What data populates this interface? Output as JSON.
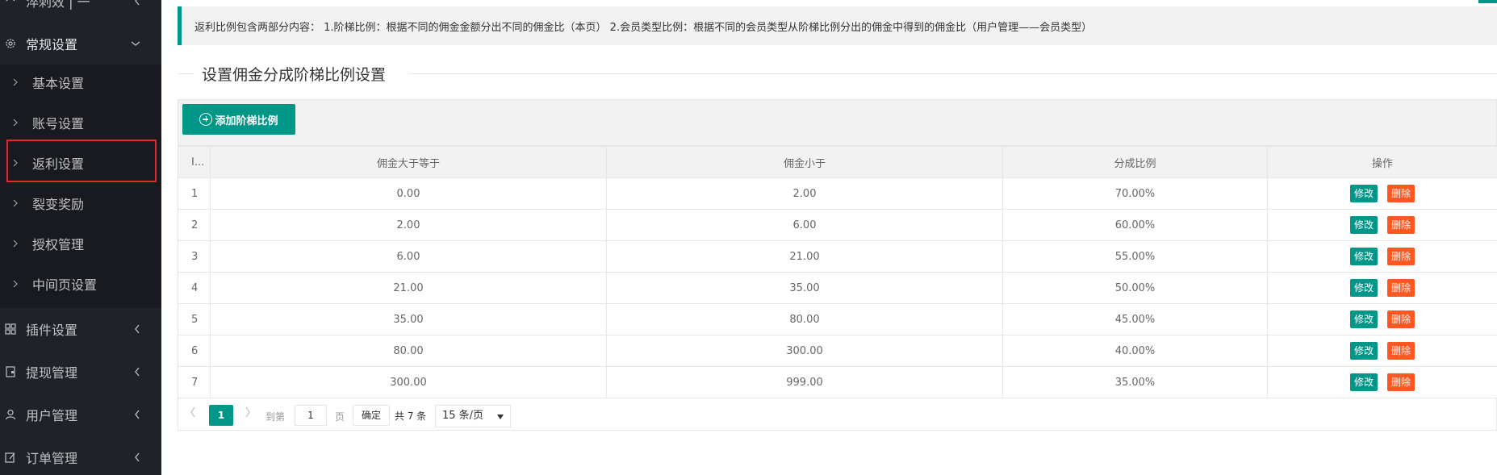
{
  "sidebar": {
    "top_item": "淬刺效 | 一",
    "general": {
      "label": "常规设置"
    },
    "sub_items": [
      {
        "label": "基本设置"
      },
      {
        "label": "账号设置"
      },
      {
        "label": "返利设置"
      },
      {
        "label": "裂变奖励"
      },
      {
        "label": "授权管理"
      },
      {
        "label": "中间页设置"
      }
    ],
    "groups": [
      {
        "label": "插件设置",
        "icon": "grid-icon"
      },
      {
        "label": "提现管理",
        "icon": "wallet-icon"
      },
      {
        "label": "用户管理",
        "icon": "user-icon"
      },
      {
        "label": "订单管理",
        "icon": "edit-icon"
      }
    ]
  },
  "notice": "返利比例包含两部分内容： 1.阶梯比例：根据不同的佣金金额分出不同的佣金比（本页） 2.会员类型比例：根据不同的会员类型从阶梯比例分出的佣金中得到的佣金比（用户管理——会员类型）",
  "section_title": "设置佣金分成阶梯比例设置",
  "toolbar": {
    "add_label": "添加阶梯比例"
  },
  "table": {
    "headers": [
      "I...",
      "佣金大于等于",
      "佣金小于",
      "分成比例",
      "操作"
    ],
    "rows": [
      [
        "1",
        "0.00",
        "2.00",
        "70.00%"
      ],
      [
        "2",
        "2.00",
        "6.00",
        "60.00%"
      ],
      [
        "3",
        "6.00",
        "21.00",
        "55.00%"
      ],
      [
        "4",
        "21.00",
        "35.00",
        "50.00%"
      ],
      [
        "5",
        "35.00",
        "80.00",
        "45.00%"
      ],
      [
        "6",
        "80.00",
        "300.00",
        "40.00%"
      ],
      [
        "7",
        "300.00",
        "999.00",
        "35.00%"
      ]
    ],
    "edit_label": "修改",
    "delete_label": "删除"
  },
  "pager": {
    "current": "1",
    "goto_label": "到第",
    "goto_value": "1",
    "page_label": "页",
    "confirm_label": "确定",
    "total": "共 7 条",
    "page_size": "15 条/页"
  },
  "colors": {
    "accent": "#009688",
    "danger": "#ff5722",
    "sidebar_bg": "#20222a",
    "highlight": "#e0282e"
  }
}
